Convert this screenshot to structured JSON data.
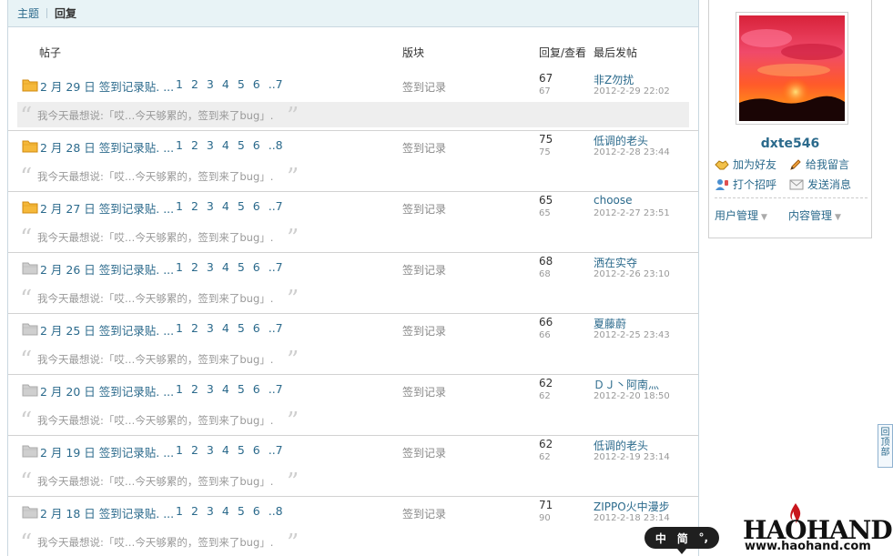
{
  "tabs": {
    "topic": "主题",
    "reply": "回复"
  },
  "columns": {
    "post": "帖子",
    "forum": "版块",
    "stats": "回复/查看",
    "last": "最后发帖"
  },
  "rows": [
    {
      "title": "2 月 29 日 签到记录贴. ...",
      "pages": [
        "1",
        "2",
        "3",
        "4",
        "5",
        "6",
        "..7"
      ],
      "forum": "签到记录",
      "replies": "67",
      "views": "67",
      "last_user": "非Z勿扰",
      "last_date": "2012-2-29 22:02",
      "quote": "我今天最想说:「哎…今天够累的，签到来了bug」.",
      "icon": "folder-new"
    },
    {
      "title": "2 月 28 日 签到记录贴. ...",
      "pages": [
        "1",
        "2",
        "3",
        "4",
        "5",
        "6",
        "..8"
      ],
      "forum": "签到记录",
      "replies": "75",
      "views": "75",
      "last_user": "低调的老头",
      "last_date": "2012-2-28 23:44",
      "quote": "我今天最想说:「哎…今天够累的，签到来了bug」.",
      "icon": "folder-new"
    },
    {
      "title": "2 月 27 日 签到记录贴. ...",
      "pages": [
        "1",
        "2",
        "3",
        "4",
        "5",
        "6",
        "..7"
      ],
      "forum": "签到记录",
      "replies": "65",
      "views": "65",
      "last_user": "choose",
      "last_date": "2012-2-27 23:51",
      "quote": "我今天最想说:「哎…今天够累的，签到来了bug」.",
      "icon": "folder-new"
    },
    {
      "title": "2 月 26 日 签到记录贴. ...",
      "pages": [
        "1",
        "2",
        "3",
        "4",
        "5",
        "6",
        "..7"
      ],
      "forum": "签到记录",
      "replies": "68",
      "views": "68",
      "last_user": "洒在实夺",
      "last_date": "2012-2-26 23:10",
      "quote": "我今天最想说:「哎…今天够累的，签到来了bug」.",
      "icon": "folder-old"
    },
    {
      "title": "2 月 25 日 签到记录贴. ...",
      "pages": [
        "1",
        "2",
        "3",
        "4",
        "5",
        "6",
        "..7"
      ],
      "forum": "签到记录",
      "replies": "66",
      "views": "66",
      "last_user": "夏藤蔚",
      "last_date": "2012-2-25 23:43",
      "quote": "我今天最想说:「哎…今天够累的，签到来了bug」.",
      "icon": "folder-old"
    },
    {
      "title": "2 月 20 日 签到记录贴. ...",
      "pages": [
        "1",
        "2",
        "3",
        "4",
        "5",
        "6",
        "..7"
      ],
      "forum": "签到记录",
      "replies": "62",
      "views": "62",
      "last_user": "ＤＪ丶阿南灬",
      "last_date": "2012-2-20 18:50",
      "quote": "我今天最想说:「哎…今天够累的，签到来了bug」.",
      "icon": "folder-old"
    },
    {
      "title": "2 月 19 日 签到记录贴. ...",
      "pages": [
        "1",
        "2",
        "3",
        "4",
        "5",
        "6",
        "..7"
      ],
      "forum": "签到记录",
      "replies": "62",
      "views": "62",
      "last_user": "低调的老头",
      "last_date": "2012-2-19 23:14",
      "quote": "我今天最想说:「哎…今天够累的，签到来了bug」.",
      "icon": "folder-old"
    },
    {
      "title": "2 月 18 日 签到记录贴. ...",
      "pages": [
        "1",
        "2",
        "3",
        "4",
        "5",
        "6",
        "..8"
      ],
      "forum": "签到记录",
      "replies": "71",
      "views": "90",
      "last_user": "ZIPPO火中漫步",
      "last_date": "2012-2-18 23:14",
      "quote": "我今天最想说:「哎…今天够累的，签到来了bug」.",
      "icon": "folder-old"
    }
  ],
  "profile": {
    "username": "dxte546",
    "add_friend": "加为好友",
    "leave_message": "给我留言",
    "greet": "打个招呼",
    "send_message": "发送消息",
    "user_manage": "用户管理",
    "content_manage": "内容管理"
  },
  "back_top": "回顶部",
  "ime": {
    "mode": "中",
    "script": "简",
    "punct": "°,"
  },
  "logo": {
    "word": "HAOHAND",
    "url": "www.haohand.com"
  },
  "colors": {
    "link": "#2b6a8c",
    "folder_new": "#f5b83a",
    "folder_old": "#cfcfcf",
    "highlight_row": "#eeeeee"
  }
}
